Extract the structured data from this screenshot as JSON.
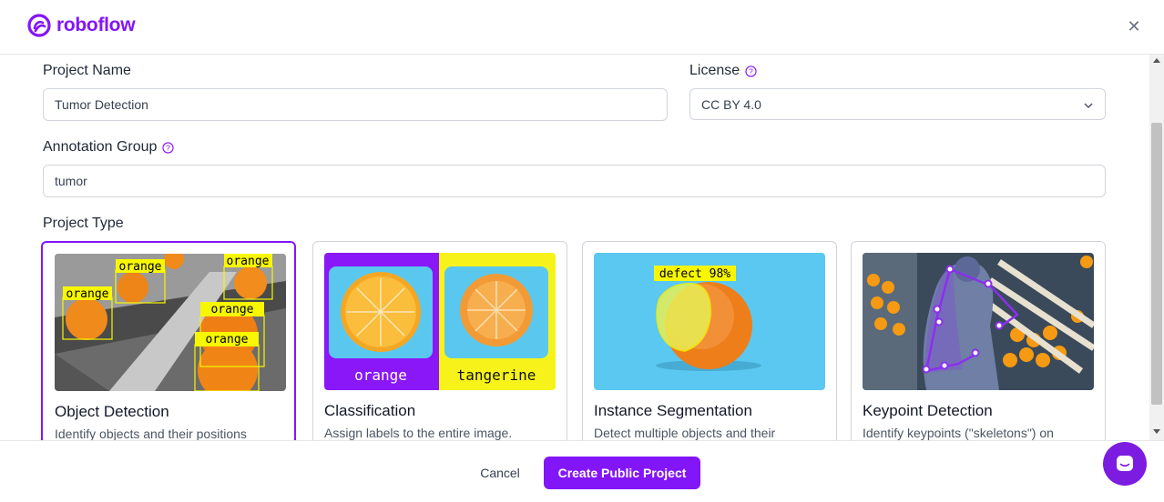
{
  "app": {
    "brand": "roboflow",
    "accent": "#8315f9"
  },
  "form": {
    "project_name": {
      "label": "Project Name",
      "value": "Tumor Detection"
    },
    "license": {
      "label": "License",
      "value": "CC BY 4.0"
    },
    "annotation_group": {
      "label": "Annotation Group",
      "value": "tumor"
    },
    "project_type": {
      "label": "Project Type"
    }
  },
  "project_types": [
    {
      "title": "Object Detection",
      "description": "Identify objects and their positions",
      "selected": true,
      "labels": [
        "orange",
        "orange",
        "orange",
        "orange",
        "orange"
      ]
    },
    {
      "title": "Classification",
      "description": "Assign labels to the entire image.",
      "selected": false,
      "labels": [
        "orange",
        "tangerine"
      ]
    },
    {
      "title": "Instance Segmentation",
      "description": "Detect multiple objects and their",
      "selected": false,
      "labels": [
        "defect 98%"
      ]
    },
    {
      "title": "Keypoint Detection",
      "description": "Identify keypoints (\"skeletons\") on",
      "selected": false,
      "labels": []
    }
  ],
  "footer": {
    "cancel_label": "Cancel",
    "create_label": "Create Public Project"
  },
  "icons": {
    "close": "close-icon",
    "help": "help-circle-icon",
    "chevron": "chevron-down-icon",
    "chat": "chat-icon"
  }
}
